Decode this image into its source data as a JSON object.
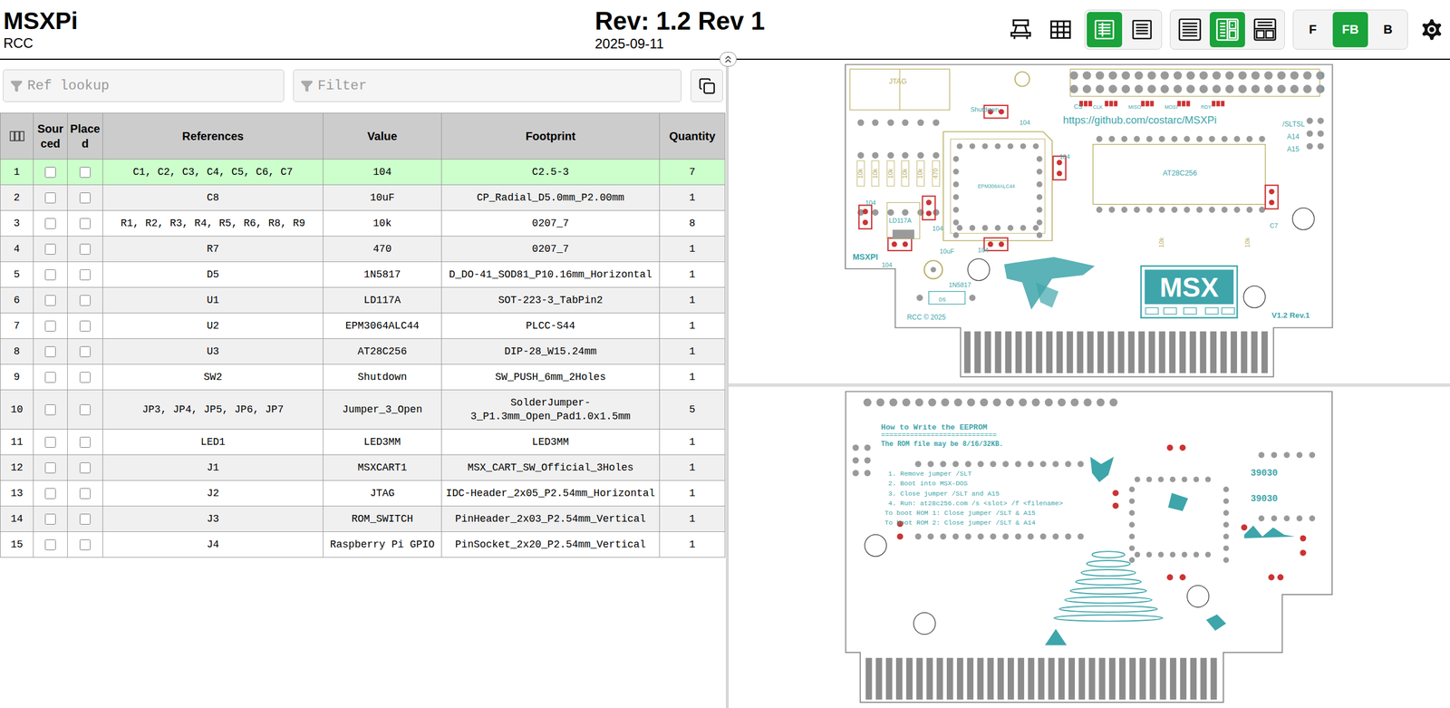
{
  "header": {
    "title": "MSXPi",
    "company": "RCC",
    "revision": "Rev: 1.2 Rev 1",
    "date": "2025-09-11"
  },
  "toolbar": {
    "tools": [
      {
        "selected": false
      },
      {
        "selected": false
      }
    ],
    "bom_modes": [
      {
        "selected": true
      },
      {
        "selected": false
      }
    ],
    "layouts": [
      {
        "selected": false
      },
      {
        "selected": true
      },
      {
        "selected": false
      }
    ],
    "layers": [
      {
        "label": "F",
        "selected": false
      },
      {
        "label": "FB",
        "selected": true
      },
      {
        "label": "B",
        "selected": false
      }
    ]
  },
  "filters": {
    "ref_placeholder": "Ref lookup",
    "filter_placeholder": "Filter"
  },
  "table": {
    "columns": [
      "Sourced",
      "Placed",
      "References",
      "Value",
      "Footprint",
      "Quantity"
    ],
    "rows": [
      {
        "num": "1",
        "sourced": false,
        "placed": false,
        "references": "C1, C2, C3, C4, C5, C6, C7",
        "value": "104",
        "footprint": "C2.5-3",
        "quantity": "7",
        "selected": true
      },
      {
        "num": "2",
        "sourced": false,
        "placed": false,
        "references": "C8",
        "value": "10uF",
        "footprint": "CP_Radial_D5.0mm_P2.00mm",
        "quantity": "1",
        "selected": false
      },
      {
        "num": "3",
        "sourced": false,
        "placed": false,
        "references": "R1, R2, R3, R4, R5, R6, R8, R9",
        "value": "10k",
        "footprint": "0207_7",
        "quantity": "8",
        "selected": false
      },
      {
        "num": "4",
        "sourced": false,
        "placed": false,
        "references": "R7",
        "value": "470",
        "footprint": "0207_7",
        "quantity": "1",
        "selected": false
      },
      {
        "num": "5",
        "sourced": false,
        "placed": false,
        "references": "D5",
        "value": "1N5817",
        "footprint": "D_DO-41_SOD81_P10.16mm_Horizontal",
        "quantity": "1",
        "selected": false
      },
      {
        "num": "6",
        "sourced": false,
        "placed": false,
        "references": "U1",
        "value": "LD117A",
        "footprint": "SOT-223-3_TabPin2",
        "quantity": "1",
        "selected": false
      },
      {
        "num": "7",
        "sourced": false,
        "placed": false,
        "references": "U2",
        "value": "EPM3064ALC44",
        "footprint": "PLCC-S44",
        "quantity": "1",
        "selected": false
      },
      {
        "num": "8",
        "sourced": false,
        "placed": false,
        "references": "U3",
        "value": "AT28C256",
        "footprint": "DIP-28_W15.24mm",
        "quantity": "1",
        "selected": false
      },
      {
        "num": "9",
        "sourced": false,
        "placed": false,
        "references": "SW2",
        "value": "Shutdown",
        "footprint": "SW_PUSH_6mm_2Holes",
        "quantity": "1",
        "selected": false
      },
      {
        "num": "10",
        "sourced": false,
        "placed": false,
        "references": "JP3, JP4, JP5, JP6, JP7",
        "value": "Jumper_3_Open",
        "footprint": "SolderJumper-3_P1.3mm_Open_Pad1.0x1.5mm",
        "quantity": "5",
        "selected": false
      },
      {
        "num": "11",
        "sourced": false,
        "placed": false,
        "references": "LED1",
        "value": "LED3MM",
        "footprint": "LED3MM",
        "quantity": "1",
        "selected": false
      },
      {
        "num": "12",
        "sourced": false,
        "placed": false,
        "references": "J1",
        "value": "MSXCART1",
        "footprint": "MSX_CART_SW_Official_3Holes",
        "quantity": "1",
        "selected": false
      },
      {
        "num": "13",
        "sourced": false,
        "placed": false,
        "references": "J2",
        "value": "JTAG",
        "footprint": "IDC-Header_2x05_P2.54mm_Horizontal",
        "quantity": "1",
        "selected": false
      },
      {
        "num": "14",
        "sourced": false,
        "placed": false,
        "references": "J3",
        "value": "ROM_SWITCH",
        "footprint": "PinHeader_2x03_P2.54mm_Vertical",
        "quantity": "1",
        "selected": false
      },
      {
        "num": "15",
        "sourced": false,
        "placed": false,
        "references": "J4",
        "value": "Raspberry Pi GPIO",
        "footprint": "PinSocket_2x20_P2.54mm_Vertical",
        "quantity": "1",
        "selected": false
      }
    ]
  },
  "pcb": {
    "front_labels": [
      "JTAG",
      "Shutdown",
      "CS",
      "CLK",
      "MISO",
      "MOSI",
      "RDY",
      "https://github.com/costarc/MSXPi",
      "1",
      "2",
      "/SLTSL",
      "A14",
      "A15",
      "AT28C256",
      "EPM3064ALC44",
      "104",
      "104",
      "104",
      "104",
      "104",
      "104",
      "10k",
      "10k",
      "10k",
      "10k",
      "10k",
      "470",
      "10k",
      "10k",
      "LD117A",
      "MSXPI",
      "10uF",
      "1N5817",
      "D5",
      "RCC © 2025",
      "V1.2 Rev.1",
      "MSX",
      "C7"
    ],
    "back_labels": [
      "How to Write the EEPROM",
      "============================",
      "The ROM file may be 8/16/32KB.",
      "39030",
      "39030"
    ],
    "back_instructions": [
      "1. Remove jumper /SLT",
      "2. Boot into MSX-DOS",
      "3. Close jumper /SLT and A15",
      "4. Run: at28c256.com /s <slot> /f <filename>",
      "To boot ROM 1: Close jumper /SLT & A15",
      "To boot ROM 2: Close jumper /SLT & A14"
    ]
  }
}
